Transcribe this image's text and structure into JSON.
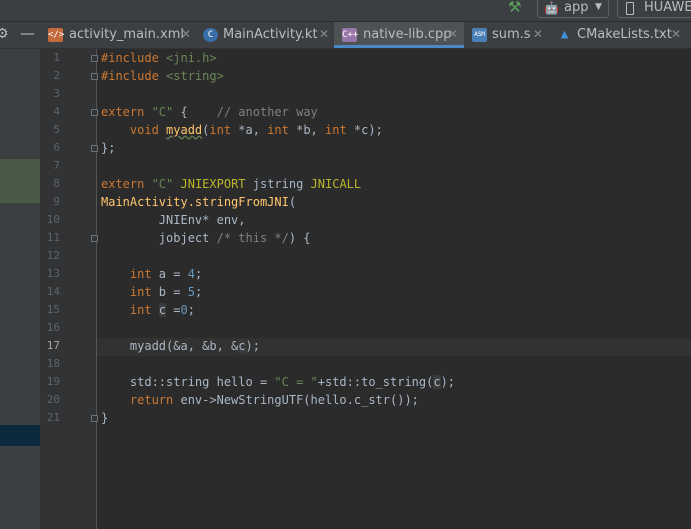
{
  "toolbar": {
    "run_config": "app",
    "device": "HUAWEI"
  },
  "tabs": [
    {
      "name": "activity_main.xml",
      "icon": "xml-file-icon",
      "icon_text": "</>"
    },
    {
      "name": "MainActivity.kt",
      "icon": "kotlin-class-icon",
      "icon_text": "C"
    },
    {
      "name": "native-lib.cpp",
      "icon": "cpp-file-icon",
      "icon_text": "C++",
      "active": true
    },
    {
      "name": "sum.s",
      "icon": "asm-file-icon",
      "icon_text": "ASM"
    },
    {
      "name": "CMakeLists.txt",
      "icon": "cmake-file-icon",
      "icon_text": "▲"
    }
  ],
  "editor": {
    "current_line": 17,
    "line_numbers": [
      "1",
      "2",
      "3",
      "4",
      "5",
      "6",
      "7",
      "8",
      "9",
      "10",
      "11",
      "12",
      "13",
      "14",
      "15",
      "16",
      "17",
      "18",
      "19",
      "20",
      "21"
    ],
    "lines": [
      [
        {
          "t": "#include ",
          "c": "kw"
        },
        {
          "t": "<jni.h>",
          "c": "str"
        }
      ],
      [
        {
          "t": "#include ",
          "c": "kw"
        },
        {
          "t": "<string>",
          "c": "str"
        }
      ],
      [],
      [
        {
          "t": "extern ",
          "c": "kw"
        },
        {
          "t": "\"C\"",
          "c": "str"
        },
        {
          "t": " {    ",
          "c": ""
        },
        {
          "t": "// another way",
          "c": "cmt"
        }
      ],
      [
        {
          "t": "    void ",
          "c": "kw"
        },
        {
          "t": "myadd",
          "c": "fn wavy"
        },
        {
          "t": "(",
          "c": ""
        },
        {
          "t": "int ",
          "c": "kw"
        },
        {
          "t": "*a, ",
          "c": ""
        },
        {
          "t": "int ",
          "c": "kw"
        },
        {
          "t": "*b, ",
          "c": ""
        },
        {
          "t": "int ",
          "c": "kw"
        },
        {
          "t": "*c);",
          "c": ""
        }
      ],
      [
        {
          "t": "};",
          "c": ""
        }
      ],
      [],
      [
        {
          "t": "extern ",
          "c": "kw"
        },
        {
          "t": "\"C\"",
          "c": "str"
        },
        {
          "t": " JNIEXPORT",
          "c": "mac"
        },
        {
          "t": " jstring ",
          "c": ""
        },
        {
          "t": "JNICALL",
          "c": "mac"
        }
      ],
      [
        {
          "t": "MainActivity.stringFromJNI",
          "c": "fn"
        },
        {
          "t": "(",
          "c": ""
        }
      ],
      [
        {
          "t": "        JNIEnv* env,",
          "c": ""
        }
      ],
      [
        {
          "t": "        jobject ",
          "c": ""
        },
        {
          "t": "/* this */",
          "c": "cmt"
        },
        {
          "t": ") {",
          "c": ""
        }
      ],
      [],
      [
        {
          "t": "    int ",
          "c": "kw"
        },
        {
          "t": "a = ",
          "c": ""
        },
        {
          "t": "4",
          "c": "num"
        },
        {
          "t": ";",
          "c": ""
        }
      ],
      [
        {
          "t": "    int ",
          "c": "kw"
        },
        {
          "t": "b = ",
          "c": ""
        },
        {
          "t": "5",
          "c": "num"
        },
        {
          "t": ";",
          "c": ""
        }
      ],
      [
        {
          "t": "    int ",
          "c": "kw"
        },
        {
          "t": "c",
          "c": "hl-var"
        },
        {
          "t": " =",
          "c": ""
        },
        {
          "t": "0",
          "c": "num"
        },
        {
          "t": ";",
          "c": ""
        }
      ],
      [],
      [
        {
          "t": "    myadd(&a, &b, &",
          "c": ""
        },
        {
          "t": "c",
          "c": "hl-var"
        },
        {
          "t": ");",
          "c": ""
        }
      ],
      [],
      [
        {
          "t": "    std::string hello = ",
          "c": ""
        },
        {
          "t": "\"C = \"",
          "c": "str"
        },
        {
          "t": "+std::to_string(",
          "c": ""
        },
        {
          "t": "c",
          "c": "hl-var"
        },
        {
          "t": ");",
          "c": ""
        }
      ],
      [
        {
          "t": "    return ",
          "c": "kw"
        },
        {
          "t": "env->NewStringUTF(hello.c_str());",
          "c": ""
        }
      ],
      [
        {
          "t": "}",
          "c": ""
        }
      ]
    ]
  },
  "colors": {
    "editor_bg": "#2b2b2b",
    "keyword": "#cc7832",
    "string": "#6a8759",
    "number": "#6897bb",
    "comment": "#808080",
    "macro": "#bbb529",
    "function": "#ffc66d",
    "active_tab_underline": "#4a88c7"
  }
}
